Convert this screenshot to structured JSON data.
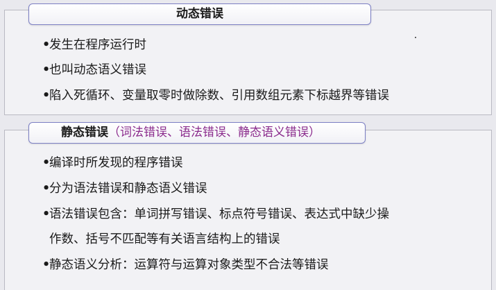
{
  "dynamic": {
    "header": "动态错误",
    "items": [
      "发生在程序运行时",
      "也叫动态语义错误",
      "陷入死循环、变量取零时做除数、引用数组元素下标越界等错误"
    ]
  },
  "static": {
    "header": "静态错误",
    "header_paren_open": "（",
    "header_paren_items": "词法错误、语法错误、静态语义错误",
    "header_paren_close": "）",
    "items": [
      "编译时所发现的程序错误",
      "分为语法错误和静态语义错误",
      "语法错误包含：单词拼写错误、标点符号错误、表达式中缺少操",
      "作数、括号不匹配等有关语言结构上的错误",
      "静态语义分析：运算符与运算对象类型不合法等错误"
    ]
  },
  "bullet_char": "•",
  "colors": {
    "accent": "#7c7fc4",
    "paren_text": "#8a2a8c",
    "background": "#e9e9ee"
  }
}
